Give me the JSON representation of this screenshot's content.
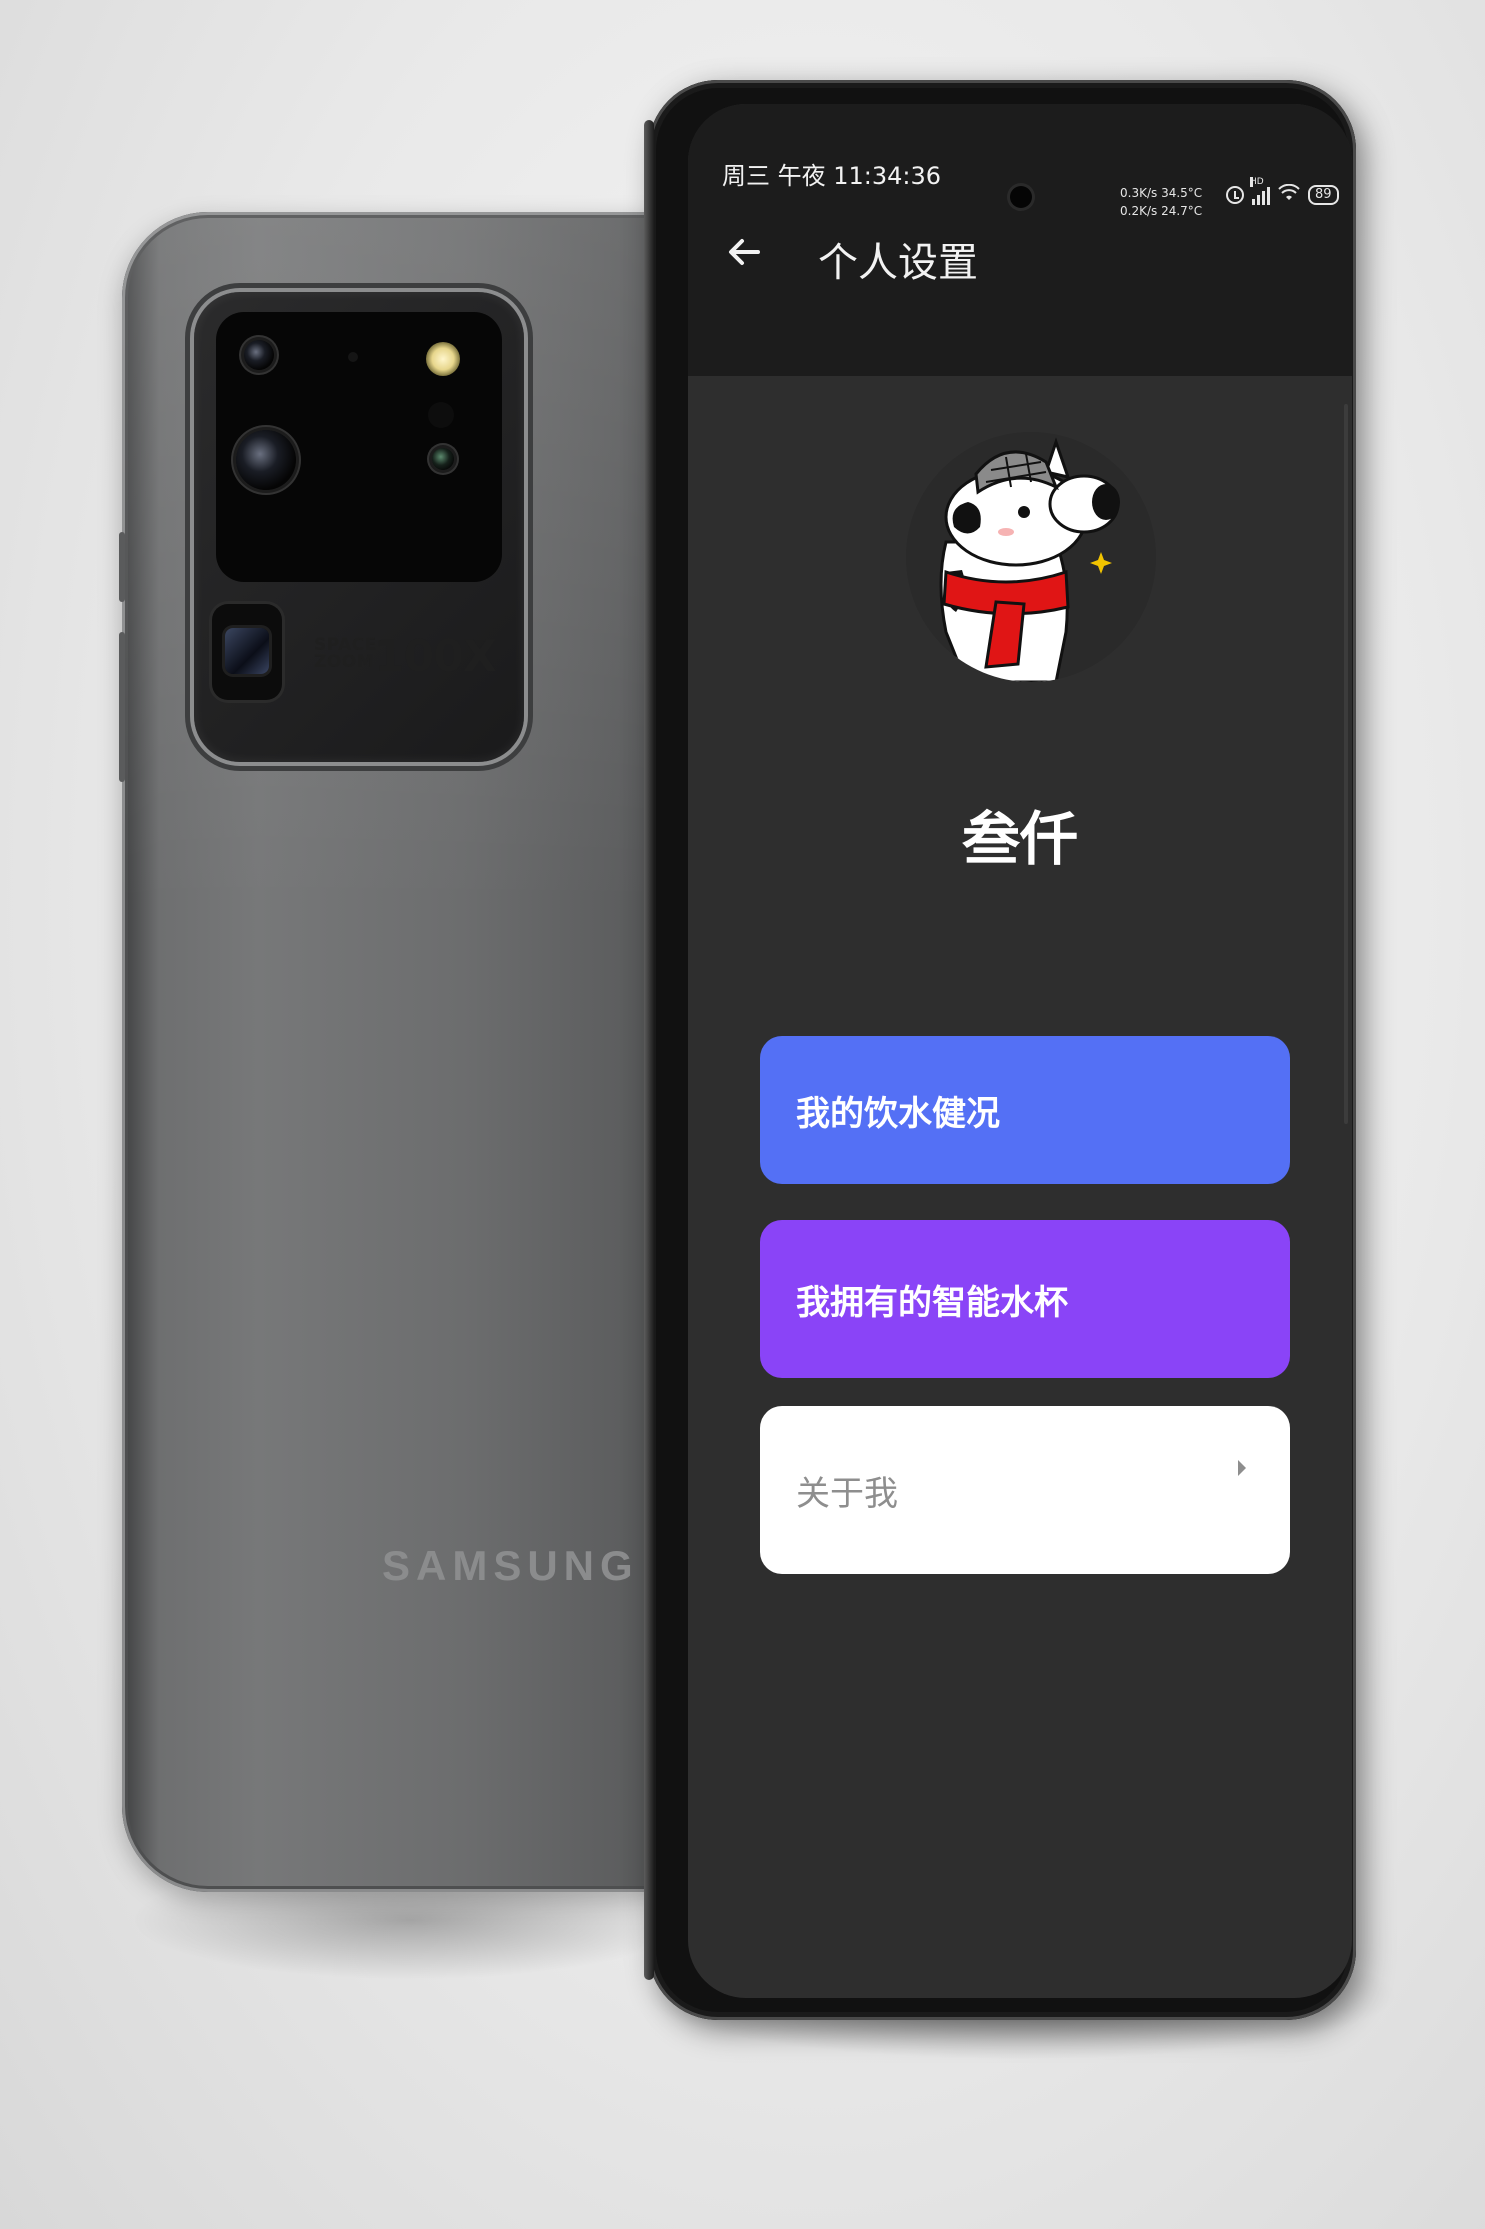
{
  "back_phone": {
    "camera_text_small_1": "SPACE",
    "camera_text_small_2": "ZOOM",
    "camera_text_big": "100X",
    "brand": "SAMSUNG"
  },
  "status_bar": {
    "time": "周三 午夜 11:34:36",
    "net_up": "0.3K/s 34.5°C",
    "net_down": "0.2K/s 24.7°C",
    "hd_label": "HD",
    "battery": "89"
  },
  "header": {
    "title": "个人设置"
  },
  "profile": {
    "name": "叁仟"
  },
  "menu": {
    "health_label": "我的饮水健况",
    "cups_label": "我拥有的智能水杯",
    "about_label": "关于我"
  },
  "colors": {
    "health_card": "#5470f5",
    "cups_card": "#8a44f7",
    "about_card": "#ffffff",
    "screen_bg": "#2e2e2e",
    "topbar_bg": "#1c1c1c"
  }
}
